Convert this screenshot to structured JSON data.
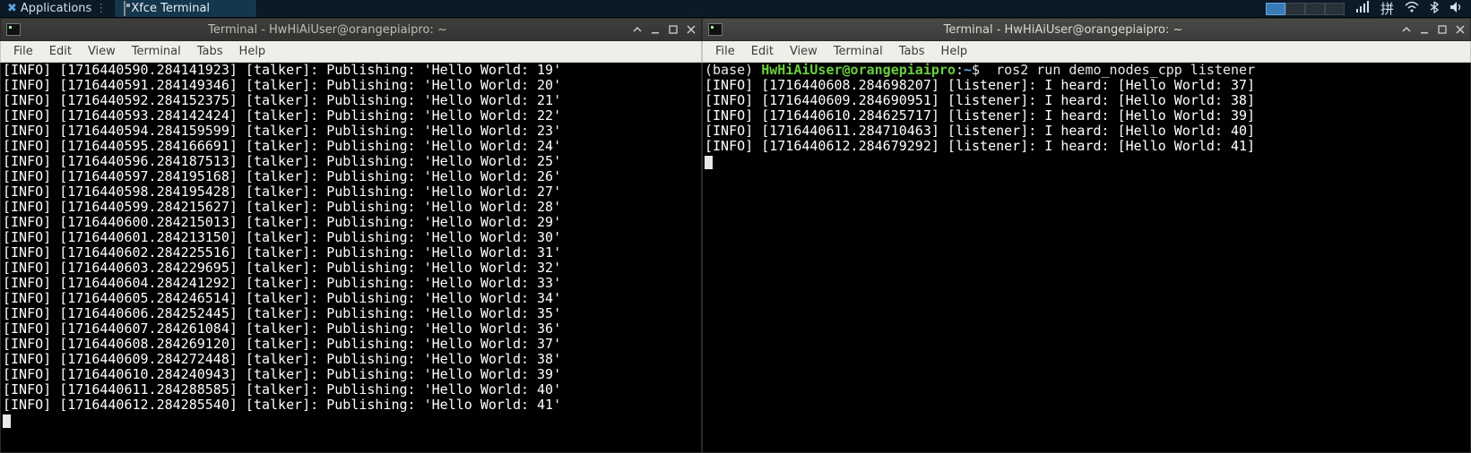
{
  "taskbar": {
    "applications_label": "Applications",
    "task_label": "Xfce Terminal",
    "pinyin_label": "拼"
  },
  "left_terminal": {
    "title": "Terminal - HwHiAiUser@orangepiaipro: ~",
    "menu": {
      "file": "File",
      "edit": "Edit",
      "view": "View",
      "terminal": "Terminal",
      "tabs": "Tabs",
      "help": "Help"
    },
    "lines": [
      "[INFO] [1716440590.284141923] [talker]: Publishing: 'Hello World: 19'",
      "[INFO] [1716440591.284149346] [talker]: Publishing: 'Hello World: 20'",
      "[INFO] [1716440592.284152375] [talker]: Publishing: 'Hello World: 21'",
      "[INFO] [1716440593.284142424] [talker]: Publishing: 'Hello World: 22'",
      "[INFO] [1716440594.284159599] [talker]: Publishing: 'Hello World: 23'",
      "[INFO] [1716440595.284166691] [talker]: Publishing: 'Hello World: 24'",
      "[INFO] [1716440596.284187513] [talker]: Publishing: 'Hello World: 25'",
      "[INFO] [1716440597.284195168] [talker]: Publishing: 'Hello World: 26'",
      "[INFO] [1716440598.284195428] [talker]: Publishing: 'Hello World: 27'",
      "[INFO] [1716440599.284215627] [talker]: Publishing: 'Hello World: 28'",
      "[INFO] [1716440600.284215013] [talker]: Publishing: 'Hello World: 29'",
      "[INFO] [1716440601.284213150] [talker]: Publishing: 'Hello World: 30'",
      "[INFO] [1716440602.284225516] [talker]: Publishing: 'Hello World: 31'",
      "[INFO] [1716440603.284229695] [talker]: Publishing: 'Hello World: 32'",
      "[INFO] [1716440604.284241292] [talker]: Publishing: 'Hello World: 33'",
      "[INFO] [1716440605.284246514] [talker]: Publishing: 'Hello World: 34'",
      "[INFO] [1716440606.284252445] [talker]: Publishing: 'Hello World: 35'",
      "[INFO] [1716440607.284261084] [talker]: Publishing: 'Hello World: 36'",
      "[INFO] [1716440608.284269120] [talker]: Publishing: 'Hello World: 37'",
      "[INFO] [1716440609.284272448] [talker]: Publishing: 'Hello World: 38'",
      "[INFO] [1716440610.284240943] [talker]: Publishing: 'Hello World: 39'",
      "[INFO] [1716440611.284288585] [talker]: Publishing: 'Hello World: 40'",
      "[INFO] [1716440612.284285540] [talker]: Publishing: 'Hello World: 41'"
    ]
  },
  "right_terminal": {
    "title": "Terminal - HwHiAiUser@orangepiaipro: ~",
    "menu": {
      "file": "File",
      "edit": "Edit",
      "view": "View",
      "terminal": "Terminal",
      "tabs": "Tabs",
      "help": "Help"
    },
    "prompt": {
      "env": "(base) ",
      "user_host": "HwHiAiUser@orangepiaipro",
      "colon": ":",
      "path": "~",
      "dollar": "$",
      "command": "  ros2 run demo_nodes_cpp listener"
    },
    "lines": [
      "[INFO] [1716440608.284698207] [listener]: I heard: [Hello World: 37]",
      "[INFO] [1716440609.284690951] [listener]: I heard: [Hello World: 38]",
      "[INFO] [1716440610.284625717] [listener]: I heard: [Hello World: 39]",
      "[INFO] [1716440611.284710463] [listener]: I heard: [Hello World: 40]",
      "[INFO] [1716440612.284679292] [listener]: I heard: [Hello World: 41]"
    ]
  }
}
